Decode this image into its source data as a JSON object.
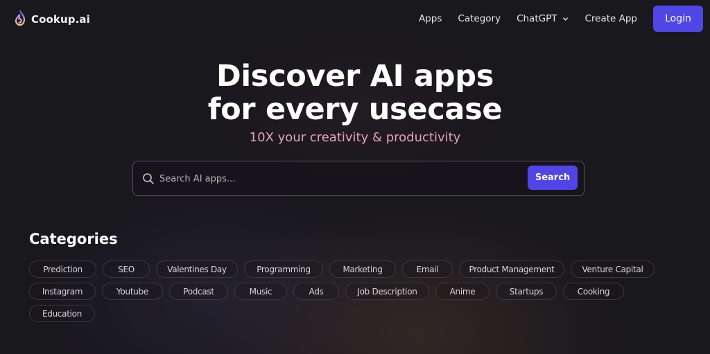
{
  "nav": {
    "logo_text": "Cookup.ai",
    "links": [
      {
        "label": "Apps"
      },
      {
        "label": "Category"
      },
      {
        "label": "ChatGPT",
        "has_dropdown": true
      },
      {
        "label": "Create App"
      }
    ],
    "login_label": "Login"
  },
  "hero": {
    "title_line1": "Discover AI apps",
    "title_line2": "for every usecase",
    "subtitle": "10X your creativity & productivity"
  },
  "search": {
    "placeholder": "Search AI apps...",
    "value": "",
    "button_label": "Search"
  },
  "categories": {
    "title": "Categories",
    "rows": [
      [
        "Prediction",
        "SEO",
        "Valentines Day",
        "Programming",
        "Marketing",
        "Email",
        "Product Management",
        "Venture Capital"
      ],
      [
        "Instagram",
        "Youtube",
        "Podcast",
        "Music",
        "Ads",
        "Job Description",
        "Anime",
        "Startups",
        "Cooking"
      ],
      [
        "Education"
      ]
    ]
  },
  "colors": {
    "accent": "#4f46e5",
    "subtitle": "#e8a2b4",
    "background": "#19181d"
  }
}
